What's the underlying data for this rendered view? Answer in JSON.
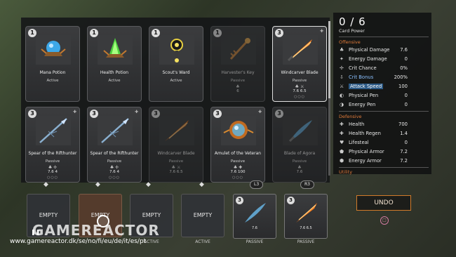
{
  "card_power": {
    "value": "0 / 6",
    "label": "Card Power"
  },
  "cards": [
    {
      "level": "1",
      "name": "Mana Potion",
      "type": "Active",
      "stats": ""
    },
    {
      "level": "1",
      "name": "Health Potion",
      "type": "Active",
      "stats": ""
    },
    {
      "level": "1",
      "name": "Scout's Ward",
      "type": "Active",
      "stats": ""
    },
    {
      "level": "1",
      "name": "Harvester's Key",
      "type": "Passive",
      "stats": "6"
    },
    {
      "level": "3",
      "name": "Windcarver Blade",
      "type": "Passive",
      "stats": "7.6  6.5"
    },
    {
      "level": "3",
      "name": "Spear of the Rifthunter",
      "type": "Passive",
      "stats": "7.6  4"
    },
    {
      "level": "3",
      "name": "Spear of the Rifthunter",
      "type": "Passive",
      "stats": "7.6  4"
    },
    {
      "level": "3",
      "name": "Windcarver Blade",
      "type": "Passive",
      "stats": "7.6  6.5"
    },
    {
      "level": "3",
      "name": "Amulet of the Veteran",
      "type": "Passive",
      "stats": "7.6  100"
    },
    {
      "level": "3",
      "name": "Blade of Agora",
      "type": "Passive",
      "stats": "7.6"
    }
  ],
  "slots": {
    "empty_label": "EMPTY",
    "items": [
      {
        "label": "EMPTY",
        "footer": ""
      },
      {
        "label": "EMPTY",
        "footer": ""
      },
      {
        "label": "EMPTY",
        "footer": "ACTIVE"
      },
      {
        "label": "EMPTY",
        "footer": "ACTIVE"
      }
    ],
    "equipped": [
      {
        "level": "3",
        "stats": "7.6",
        "footer": "PASSIVE"
      },
      {
        "level": "3",
        "stats": "7.6  6.5",
        "footer": "PASSIVE"
      }
    ],
    "pill_l3": "L3",
    "pill_r3": "R3"
  },
  "stats": {
    "offensive_label": "Offensive",
    "offensive": [
      {
        "name": "Physical Damage",
        "value": "7.6",
        "icon": "fist-icon"
      },
      {
        "name": "Energy Damage",
        "value": "0",
        "icon": "energy-icon"
      },
      {
        "name": "Crit Chance",
        "value": "0%",
        "icon": "crit-icon"
      },
      {
        "name": "Crit Bonus",
        "value": "200%",
        "icon": "crit-bonus-icon"
      },
      {
        "name": "Attack Speed",
        "value": "100",
        "icon": "attack-speed-icon"
      },
      {
        "name": "Physical Pen",
        "value": "0",
        "icon": "phys-pen-icon"
      },
      {
        "name": "Energy Pen",
        "value": "0",
        "icon": "energy-pen-icon"
      }
    ],
    "defensive_label": "Defensive",
    "defensive": [
      {
        "name": "Health",
        "value": "700",
        "icon": "health-icon"
      },
      {
        "name": "Health Regen",
        "value": "1.4",
        "icon": "regen-icon"
      },
      {
        "name": "Lifesteal",
        "value": "0",
        "icon": "lifesteal-icon"
      },
      {
        "name": "Physical Armor",
        "value": "7.2",
        "icon": "phys-armor-icon"
      },
      {
        "name": "Energy Armor",
        "value": "7.2",
        "icon": "energy-armor-icon"
      }
    ],
    "utility_label": "Utility"
  },
  "undo_label": "UNDO",
  "watermark": "GAMEREACTOR",
  "watermark_url": "www.gamereactor.dk/se/no/fi/eu/de/it/es/pt"
}
